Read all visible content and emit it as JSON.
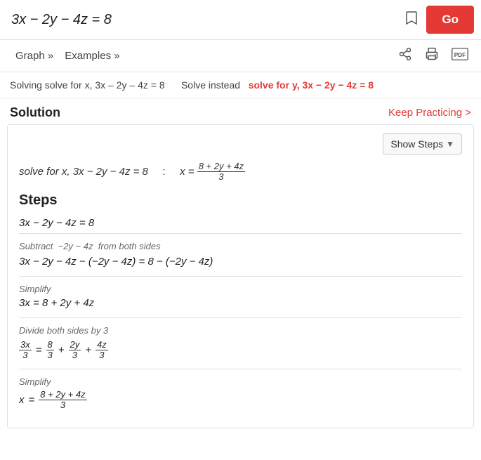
{
  "topbar": {
    "equation": "3x − 2y − 4z = 8",
    "go_label": "Go"
  },
  "nav": {
    "graph_label": "Graph »",
    "examples_label": "Examples »"
  },
  "solving": {
    "prefix": "Solving solve for x, 3x – 2y – 4z = 8",
    "solve_instead_prefix": "Solve instead",
    "solve_instead_link": "solve for y, 3x − 2y − 4z = 8"
  },
  "solution": {
    "title": "Solution",
    "keep_practicing": "Keep Practicing >"
  },
  "show_steps": {
    "label": "Show Steps"
  },
  "result": {
    "prefix": "solve for x, 3x − 2y − 4z = 8",
    "separator": ":",
    "answer_prefix": "x ="
  },
  "steps": {
    "heading": "Steps",
    "initial_eq": "3x − 2y − 4z = 8",
    "step1": {
      "note": "Subtract  − 2y − 4z from both sides",
      "eq": "3x − 2y − 4z − (−2y − 4z) = 8 − (−2y − 4z)"
    },
    "step2": {
      "note": "Simplify",
      "eq": "3x = 8 + 2y + 4z"
    },
    "step3": {
      "note": "Divide both sides by 3"
    },
    "step4": {
      "note": "Simplify"
    }
  }
}
